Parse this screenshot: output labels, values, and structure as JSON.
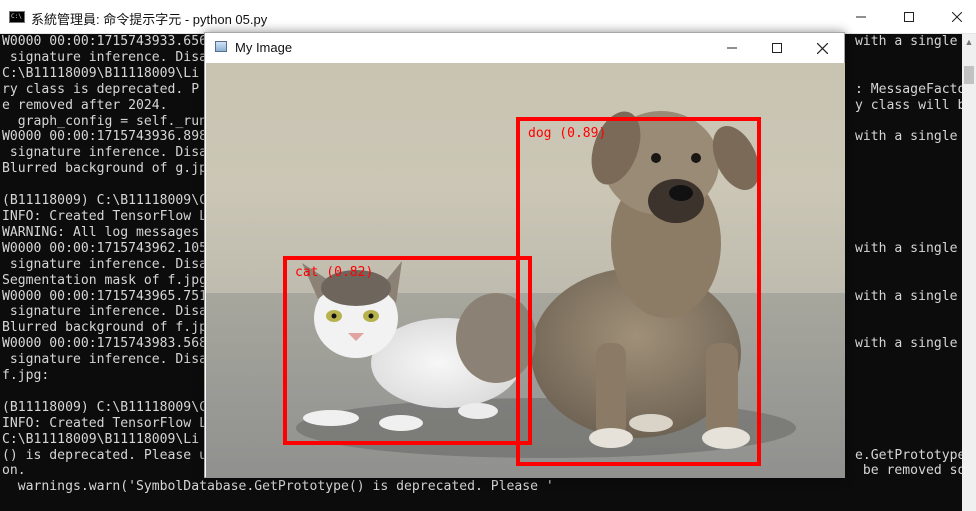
{
  "console_window": {
    "title": "系統管理員: 命令提示字元 - python  05.py",
    "icon": "cmd-icon",
    "controls": [
      "minimize-icon",
      "maximize-icon",
      "close-icon"
    ]
  },
  "console_lines": [
    "W0000 00:00:1715743933.656",
    " signature inference. Disa",
    "C:\\B11118009\\B11118009\\Li",
    "ry class is deprecated. P",
    "e removed after 2024.",
    "  graph_config = self._run",
    "W0000 00:00:1715743936.898",
    " signature inference. Disa",
    "Blurred background of g.jp",
    "",
    "(B11118009) C:\\B11118009\\C",
    "INFO: Created TensorFlow L",
    "WARNING: All log messages",
    "W0000 00:00:1715743962.105",
    " signature inference. Disa",
    "Segmentation mask of f.jpg",
    "W0000 00:00:1715743965.751",
    " signature inference. Disa",
    "Blurred background of f.jp",
    "W0000 00:00:1715743983.568",
    " signature inference. Disa",
    "f.jpg:",
    "",
    "(B11118009) C:\\B11118009\\C",
    "INFO: Created TensorFlow L",
    "C:\\B11118009\\B11118009\\Li",
    "() is deprecated. Please u",
    "on.",
    "  warnings.warn('SymbolDatabase.GetPrototype() is deprecated. Please '"
  ],
  "console_right_fragments": [
    {
      "line": 0,
      "text": "with a single"
    },
    {
      "line": 3,
      "text": ": MessageFacto"
    },
    {
      "line": 4,
      "text": "y class will b"
    },
    {
      "line": 6,
      "text": "with a single"
    },
    {
      "line": 13,
      "text": "with a single"
    },
    {
      "line": 16,
      "text": "with a single"
    },
    {
      "line": 19,
      "text": "with a single"
    },
    {
      "line": 26,
      "text": "e.GetPrototype"
    },
    {
      "line": 27,
      "text": " be removed so"
    }
  ],
  "image_window": {
    "title": "My Image",
    "icon": "image-window-icon",
    "controls": [
      "minimize-icon",
      "maximize-icon",
      "close-icon"
    ]
  },
  "detections": [
    {
      "label": "cat (0.82)",
      "color": "#ff0000"
    },
    {
      "label": "dog (0.89)",
      "color": "#ff0000"
    }
  ]
}
